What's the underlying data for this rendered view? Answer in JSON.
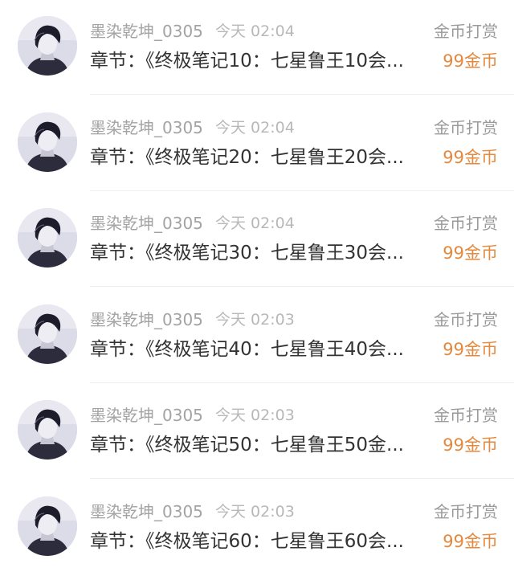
{
  "tips": [
    {
      "username": "墨染乾坤_0305",
      "time": "今天 02:04",
      "tip_label": "金币打赏",
      "chapter": "章节：《终极笔记10：七星鲁王10会...",
      "amount": "99金币"
    },
    {
      "username": "墨染乾坤_0305",
      "time": "今天 02:04",
      "tip_label": "金币打赏",
      "chapter": "章节：《终极笔记20：七星鲁王20会...",
      "amount": "99金币"
    },
    {
      "username": "墨染乾坤_0305",
      "time": "今天 02:04",
      "tip_label": "金币打赏",
      "chapter": "章节：《终极笔记30：七星鲁王30会...",
      "amount": "99金币"
    },
    {
      "username": "墨染乾坤_0305",
      "time": "今天 02:03",
      "tip_label": "金币打赏",
      "chapter": "章节：《终极笔记40：七星鲁王40会...",
      "amount": "99金币"
    },
    {
      "username": "墨染乾坤_0305",
      "time": "今天 02:03",
      "tip_label": "金币打赏",
      "chapter": "章节：《终极笔记50：七星鲁王50金...",
      "amount": "99金币"
    },
    {
      "username": "墨染乾坤_0305",
      "time": "今天 02:03",
      "tip_label": "金币打赏",
      "chapter": "章节：《终极笔记60：七星鲁王60会...",
      "amount": "99金币"
    }
  ],
  "colors": {
    "username": "#a3a3a3",
    "time": "#b8b8b8",
    "chapter": "#333333",
    "amount": "#e4893e"
  },
  "icons": {
    "avatar": "user-avatar-photo"
  }
}
